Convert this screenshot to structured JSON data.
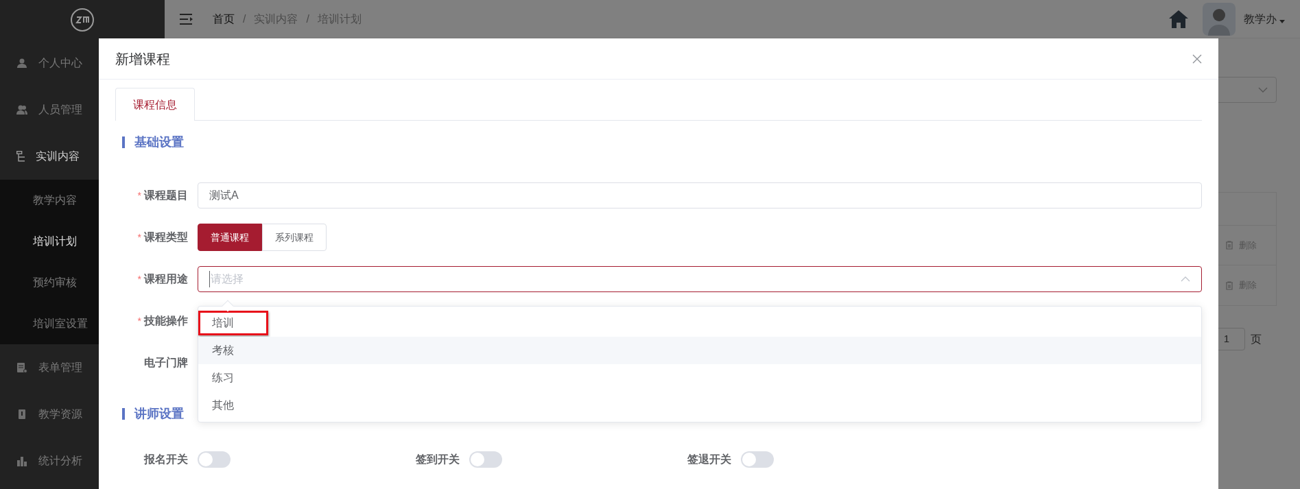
{
  "sidebar": {
    "items": [
      {
        "label": "个人中心",
        "expanded": false
      },
      {
        "label": "人员管理",
        "expanded": false
      },
      {
        "label": "实训内容",
        "expanded": true,
        "children": [
          {
            "label": "教学内容",
            "selected": false
          },
          {
            "label": "培训计划",
            "selected": true
          },
          {
            "label": "预约审核",
            "selected": false
          },
          {
            "label": "培训室设置",
            "selected": false
          }
        ]
      },
      {
        "label": "表单管理",
        "expanded": false
      },
      {
        "label": "教学资源",
        "expanded": false
      },
      {
        "label": "统计分析",
        "expanded": false
      }
    ]
  },
  "header": {
    "breadcrumb": [
      "首页",
      "实训内容",
      "培训计划"
    ],
    "separator": "/",
    "user": "教学办"
  },
  "background": {
    "row_actions": [
      "删除",
      "删除"
    ],
    "page_input": "1",
    "page_suffix": "页"
  },
  "dialog": {
    "title": "新增课程",
    "tabs": [
      {
        "label": "课程信息",
        "selected": true
      }
    ],
    "required_mark": "*",
    "sections": [
      {
        "title": "基础设置"
      },
      {
        "title": "讲师设置"
      }
    ],
    "fields": [
      {
        "kind": "text",
        "label": "课程题目",
        "required": true,
        "value": "测试A"
      },
      {
        "kind": "segmented",
        "label": "课程类型",
        "required": true,
        "options": [
          {
            "label": "普通课程",
            "selected": true
          },
          {
            "label": "系列课程",
            "selected": false
          }
        ]
      },
      {
        "kind": "select",
        "label": "课程用途",
        "required": true,
        "placeholder": "请选择",
        "open": true
      },
      {
        "kind": "hidden",
        "label": "技能操作",
        "required": true
      },
      {
        "kind": "hidden",
        "label": "电子门牌",
        "required": false
      }
    ],
    "dropdown": [
      {
        "label": "培训",
        "hovered": false,
        "annotated": true
      },
      {
        "label": "考核",
        "hovered": true,
        "annotated": false
      },
      {
        "label": "练习",
        "hovered": false,
        "annotated": false
      },
      {
        "label": "其他",
        "hovered": false,
        "annotated": false
      }
    ],
    "switches": [
      {
        "label": "报名开关",
        "on": false
      },
      {
        "label": "签到开关",
        "on": false
      },
      {
        "label": "签退开关",
        "on": false
      }
    ]
  }
}
